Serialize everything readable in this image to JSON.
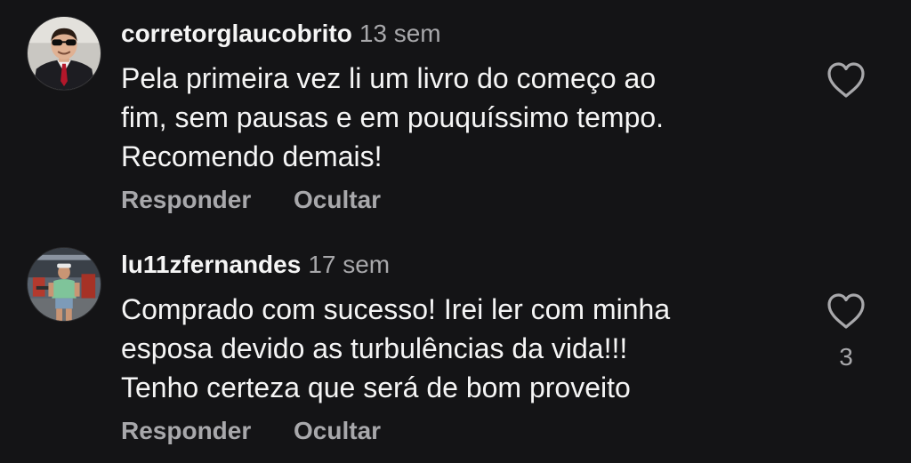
{
  "comments": [
    {
      "username": "corretorglaucobrito",
      "time": "13 sem",
      "text_lines": [
        "Pela primeira vez li um livro do começo ao",
        "fim, sem pausas e em pouquíssimo tempo.",
        "Recomendo demais!"
      ],
      "reply_label": "Responder",
      "hide_label": "Ocultar",
      "avatar_icon": "profile-photo-man-suit-sunglasses"
    },
    {
      "username": "lu11zfernandes",
      "time": "17 sem",
      "text_lines": [
        "Comprado com sucesso! Irei ler com minha",
        "esposa devido as turbulências da vida!!!",
        "Tenho certeza que será de bom proveito"
      ],
      "reply_label": "Responder",
      "hide_label": "Ocultar",
      "like_count": "3",
      "avatar_icon": "profile-photo-man-gym"
    }
  ],
  "colors": {
    "background": "#141416",
    "primary_text": "#f5f5f5",
    "secondary_text": "#a8a8ab"
  }
}
